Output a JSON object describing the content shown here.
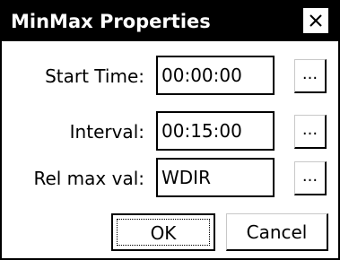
{
  "window": {
    "title": "MinMax Properties",
    "close_symbol": "close-icon"
  },
  "form": {
    "start_time": {
      "label": "Start Time:",
      "value": "00:00:00",
      "button": "..."
    },
    "interval": {
      "label": "Interval:",
      "value": "00:15:00",
      "button": "..."
    },
    "rel_max_val": {
      "label": "Rel max val:",
      "value": "WDIR",
      "button": "..."
    }
  },
  "buttons": {
    "ok": "OK",
    "cancel": "Cancel"
  }
}
